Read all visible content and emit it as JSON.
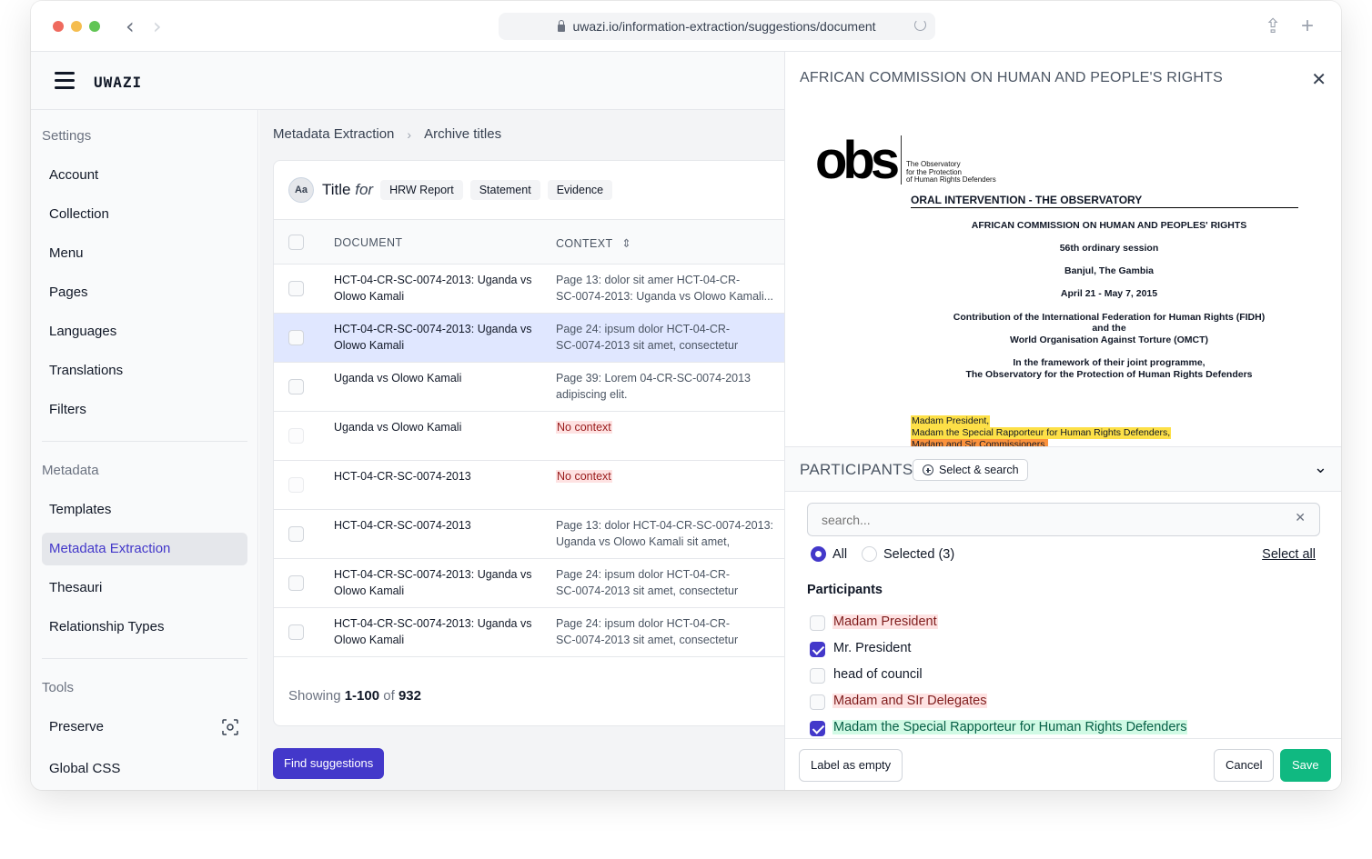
{
  "browser": {
    "url": "uwazi.io/information-extraction/suggestions/document",
    "back_glyph": "‹",
    "forward_glyph": "›",
    "share_glyph": "⇪",
    "newtab_glyph": "+"
  },
  "app": {
    "logo": "UWAZI"
  },
  "sidebar": {
    "settings_heading": "Settings",
    "settings_items": [
      "Account",
      "Collection",
      "Menu",
      "Pages",
      "Languages",
      "Translations",
      "Filters"
    ],
    "metadata_heading": "Metadata",
    "metadata_items": [
      "Templates",
      "Metadata Extraction",
      "Thesauri",
      "Relationship Types"
    ],
    "active_item": "Metadata Extraction",
    "tools_heading": "Tools",
    "tools_items": [
      "Preserve",
      "Global CSS"
    ]
  },
  "main": {
    "breadcrumb": [
      "Metadata Extraction",
      "Archive titles"
    ],
    "breadcrumb_sep": "›",
    "card": {
      "icon_text": "Aa",
      "title": "Title",
      "title_for": "for",
      "templates": [
        "HRW Report",
        "Statement",
        "Evidence"
      ]
    },
    "table": {
      "columns": [
        "DOCUMENT",
        "CONTEXT"
      ],
      "sort_glyph": "⇕",
      "rows": [
        {
          "doc": "HCT-04-CR-SC-0074-2013: Uganda vs Olowo Kamali",
          "ctx_pre": "Page 13: dolor sit amer ",
          "ctx_bold": "HCT-04-CR-SC-0074-2013: Uganda vs Olowo Kamali...",
          "ctx_post": "",
          "ctx_line1": "Page 13: dolor sit amer HCT-04-CR-",
          "ctx_line2": "SC-0074-2013: Uganda vs Olowo Kamali...",
          "no_context": false,
          "selected": false
        },
        {
          "doc": "HCT-04-CR-SC-0074-2013: Uganda vs Olowo Kamali",
          "ctx_line1": "Page 24: ipsum dolor HCT-04-CR-",
          "ctx_line2": "SC-0074-2013 sit amet, consectetur",
          "no_context": false,
          "selected": true
        },
        {
          "doc": "Uganda vs Olowo Kamali",
          "ctx_line1": "Page 39: Lorem 04-CR-SC-0074-2013",
          "ctx_line2": "adipiscing elit.",
          "no_context": false,
          "selected": false
        },
        {
          "doc": "Uganda vs Olowo Kamali",
          "ctx_line1": "No context",
          "ctx_line2": "",
          "no_context": true,
          "selected": false
        },
        {
          "doc": "HCT-04-CR-SC-0074-2013",
          "ctx_line1": "No context",
          "ctx_line2": "",
          "no_context": true,
          "selected": false
        },
        {
          "doc": "HCT-04-CR-SC-0074-2013",
          "ctx_line1": "Page 13: dolor HCT-04-CR-SC-0074-2013:",
          "ctx_line2": "Uganda vs Olowo Kamali sit amet,",
          "no_context": false,
          "selected": false
        },
        {
          "doc": "HCT-04-CR-SC-0074-2013: Uganda vs Olowo Kamali",
          "ctx_line1": "Page 24: ipsum dolor HCT-04-CR-",
          "ctx_line2": "SC-0074-2013 sit amet, consectetur",
          "no_context": false,
          "selected": false
        },
        {
          "doc": "HCT-04-CR-SC-0074-2013: Uganda vs Olowo Kamali",
          "ctx_line1": "Page 24: ipsum dolor HCT-04-CR-",
          "ctx_line2": "SC-0074-2013 sit amet, consectetur",
          "no_context": false,
          "selected": false
        }
      ]
    },
    "showing": {
      "prefix": "Showing",
      "range": "1-100",
      "of": "of",
      "total": "932"
    },
    "find_button": "Find suggestions"
  },
  "panel": {
    "title": "AFRICAN COMMISSION ON HUMAN AND PEOPLE'S RIGHTS",
    "close_glyph": "✕",
    "pdf": {
      "logo": "obs",
      "logo_sub": [
        "The Observatory",
        "for the Protection",
        "of Human Rights Defenders"
      ],
      "heading": "ORAL INTERVENTION - THE OBSERVATORY",
      "lines": [
        "AFRICAN COMMISSION ON HUMAN AND PEOPLES' RIGHTS",
        "56th ordinary session",
        "Banjul, The Gambia",
        "April 21 - May 7, 2015",
        "Contribution of the International Federation for Human Rights (FIDH)",
        "and the",
        "World Organisation Against Torture (OMCT)",
        "In the framework of their joint programme,",
        "The Observatory for the Protection of Human Rights Defenders"
      ],
      "highlights": [
        "Madam President,",
        "Madam the Special Rapporteur for Human Rights Defenders,",
        "Madam and Sir Commissioners,"
      ]
    },
    "property": {
      "title": "PARTICIPANTS",
      "select_search": "Select & search",
      "chevron_glyph": "⌄"
    },
    "search": {
      "placeholder": "search...",
      "clear_glyph": "✕"
    },
    "filter": {
      "all": "All",
      "selected": "Selected (3)",
      "select_all": "Select all"
    },
    "list_title": "Participants",
    "options": [
      {
        "label": "Madam President",
        "checked": false,
        "tone": "red"
      },
      {
        "label": "Mr. President",
        "checked": true,
        "tone": "none"
      },
      {
        "label": "head of council",
        "checked": false,
        "tone": "none"
      },
      {
        "label": "Madam and SIr Delegates",
        "checked": false,
        "tone": "red"
      },
      {
        "label": "Madam the Special Rapporteur for Human Rights Defenders",
        "checked": true,
        "tone": "green"
      }
    ],
    "footer": {
      "label_empty": "Label as empty",
      "cancel": "Cancel",
      "save": "Save"
    }
  },
  "colors": {
    "accent": "#4338ca",
    "save": "#10b981",
    "selected_row": "#e0e7ff",
    "no_context_bg": "#fee2e2",
    "highlight_yellow": "#fde047",
    "highlight_orange": "#fb923c"
  }
}
